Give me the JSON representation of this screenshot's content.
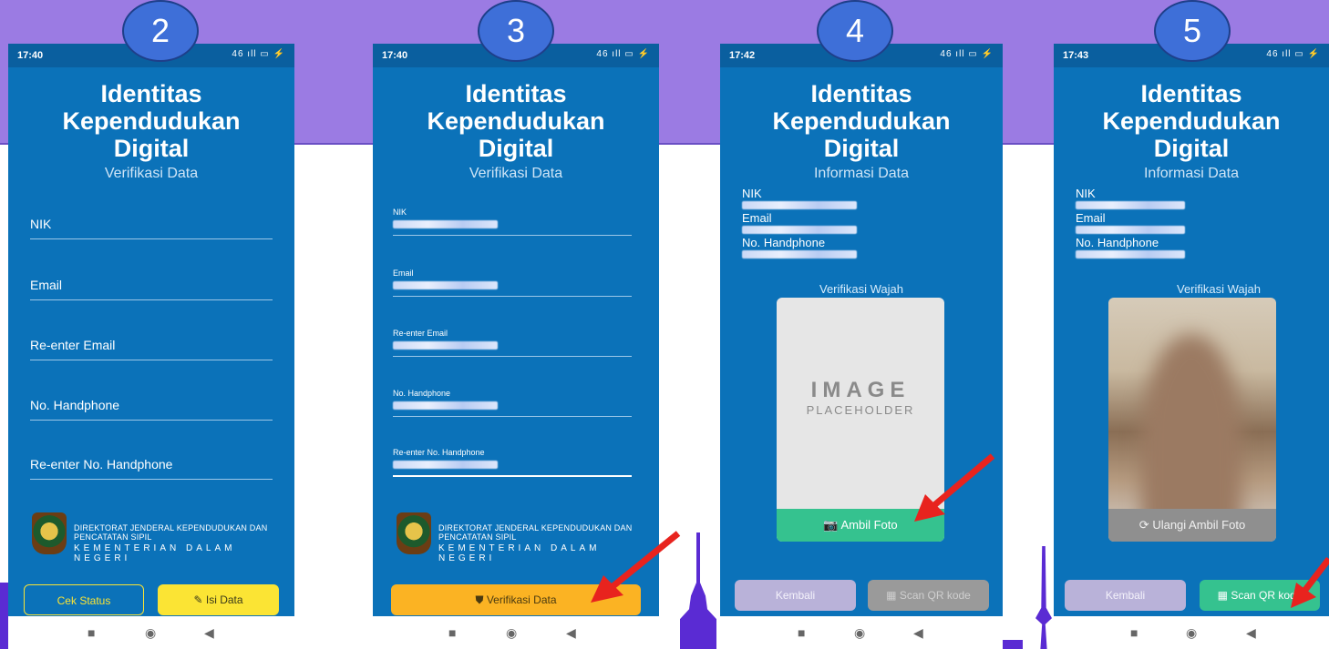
{
  "steps": [
    "2",
    "3",
    "4",
    "5"
  ],
  "status_time": [
    "17:40",
    "17:40",
    "17:42",
    "17:43"
  ],
  "status_icons": "46 ıll ▭ ⚡",
  "app": {
    "title_l1": "Identitas",
    "title_l2": "Kependudukan",
    "title_l3": "Digital"
  },
  "subtitles": {
    "verify": "Verifikasi Data",
    "info": "Informasi Data"
  },
  "form": {
    "nik": "NIK",
    "email": "Email",
    "reemail": "Re-enter Email",
    "phone": "No. Handphone",
    "rephone": "Re-enter No. Handphone"
  },
  "logo": {
    "line1": "DIREKTORAT JENDERAL KEPENDUDUKAN DAN PENCATATAN SIPIL",
    "line2": "KEMENTERIAN DALAM NEGERI"
  },
  "buttons": {
    "cek_status": "Cek Status",
    "isi_data": "Isi Data",
    "verifikasi": "Verifikasi Data",
    "ambil_foto": "Ambil Foto",
    "ulangi_foto": "Ulangi Ambil Foto",
    "kembali": "Kembali",
    "scan_qr": "Scan QR kode"
  },
  "face": {
    "title": "Verifikasi Wajah",
    "placeholder_l1": "IMAGE",
    "placeholder_l2": "PLACEHOLDER"
  },
  "nav_icons": [
    "■",
    "◉",
    "◀"
  ],
  "colors": {
    "banner": "#9b7be3",
    "app_blue": "#0b72b9",
    "yellow": "#fbe434",
    "green": "#35c28f",
    "arrow": "#e8231e"
  }
}
